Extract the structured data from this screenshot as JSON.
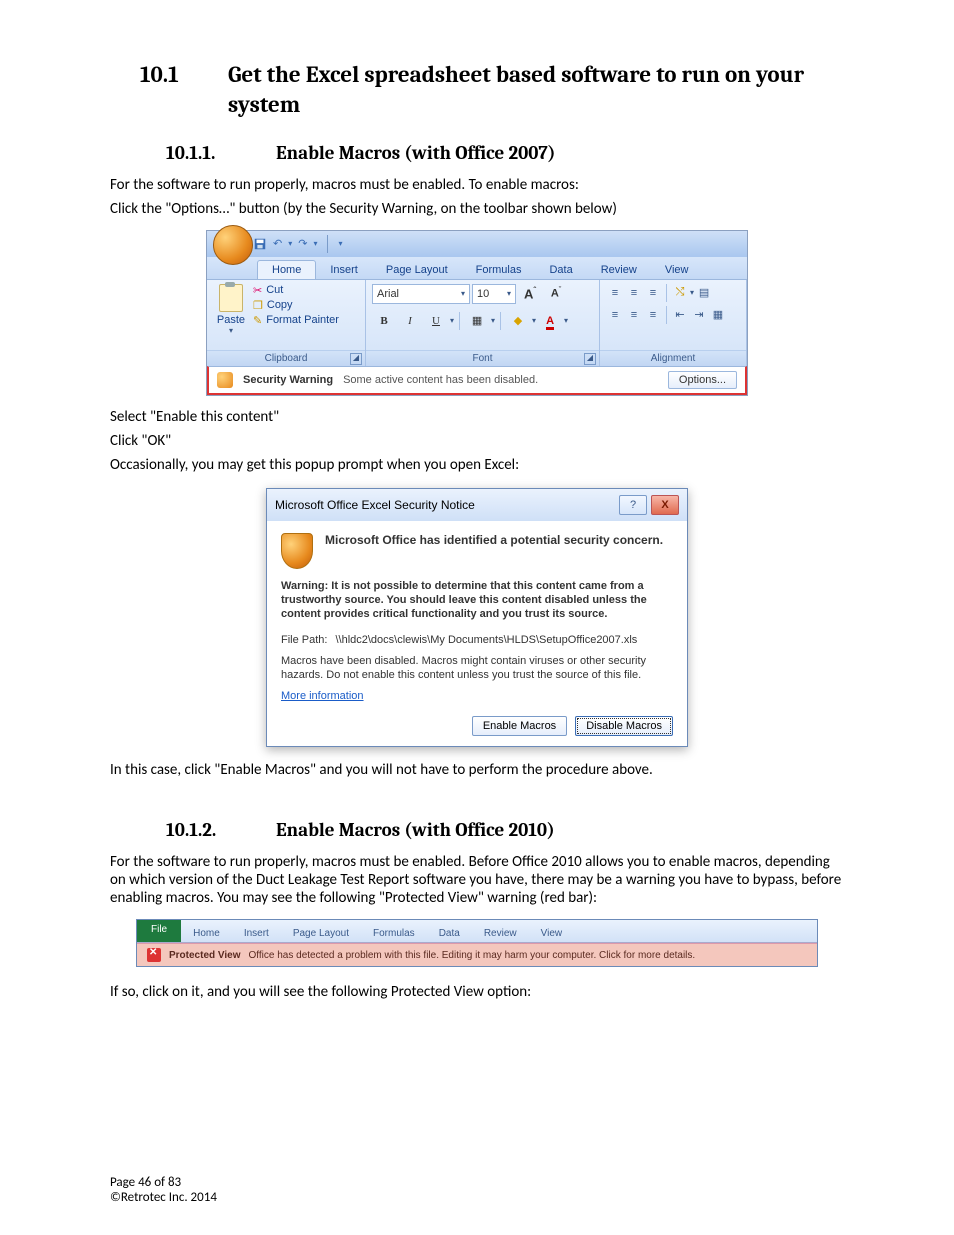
{
  "heading1": {
    "num": "10.1",
    "text": "Get the Excel spreadsheet based software to run on your system"
  },
  "section1": {
    "num": "10.1.1.",
    "title": "Enable Macros (with Office 2007)",
    "p1": "For the software to run properly, macros must be enabled.  To enable macros:",
    "p2": "Click the \"Options…\" button (by the Security Warning, on the toolbar shown below)",
    "p3": "Select \"Enable this content\"",
    "p4": "Click \"OK\"",
    "p5": "Occasionally, you may get this popup prompt when you open Excel:",
    "p6": "In this case, click \"Enable Macros\" and you will not have to perform the procedure above."
  },
  "section2": {
    "num": "10.1.2.",
    "title": "Enable Macros (with Office 2010)",
    "p1": "For the software to run properly, macros must be enabled.  Before Office 2010  allows you to enable macros, depending on which version of the Duct Leakage Test Report software you have, there may be a warning you have to bypass, before enabling macros. You may see the following \"Protected View\" warning (red bar):",
    "p2": "If so, click on it, and you will see the following Protected View option:"
  },
  "ribbon": {
    "tabs": {
      "home": "Home",
      "insert": "Insert",
      "pagelayout": "Page Layout",
      "formulas": "Formulas",
      "data": "Data",
      "review": "Review",
      "view": "View"
    },
    "clipboard": {
      "label": "Clipboard",
      "paste": "Paste",
      "cut": "Cut",
      "copy": "Copy",
      "format": "Format Painter"
    },
    "font": {
      "label": "Font",
      "name": "Arial",
      "size": "10"
    },
    "alignment": {
      "label": "Alignment"
    },
    "security": {
      "label": "Security Warning",
      "msg": "Some active content has been disabled.",
      "options": "Options..."
    }
  },
  "dialog": {
    "title": "Microsoft Office Excel Security Notice",
    "headline": "Microsoft Office has identified a potential security concern.",
    "warning": "Warning: It is not possible to determine that this content came from a trustworthy source. You should leave this content disabled unless the content provides critical functionality and you trust its source.",
    "filepath_label": "File Path:",
    "filepath": "\\\\hldc2\\docs\\clewis\\My Documents\\HLDS\\SetupOffice2007.xls",
    "body2": "Macros have been disabled. Macros might contain viruses or other security hazards. Do not enable this content unless you trust the source of this file.",
    "more": "More information",
    "enable": "Enable Macros",
    "disable": "Disable Macros"
  },
  "pv": {
    "file": "File",
    "tabs": {
      "home": "Home",
      "insert": "Insert",
      "pagelayout": "Page Layout",
      "formulas": "Formulas",
      "data": "Data",
      "review": "Review",
      "view": "View"
    },
    "label": "Protected View",
    "msg": "Office has detected a problem with this file. Editing it may harm your computer. Click for more details."
  },
  "footer": {
    "page": "Page 46 of 83",
    "copyright": "©Retrotec Inc. 2014"
  }
}
